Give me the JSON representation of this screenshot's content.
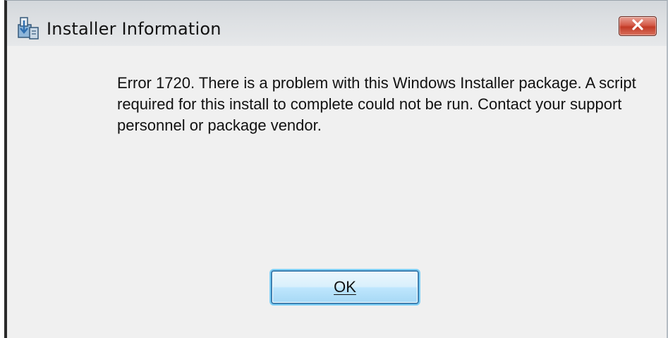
{
  "window": {
    "title": "Installer Information",
    "icon": "installer-icon",
    "close_icon": "close-icon"
  },
  "message": {
    "text": "Error 1720. There is a problem with this Windows Installer package. A script required for this install to complete could not be run. Contact your support personnel or package vendor."
  },
  "buttons": {
    "ok_label": "OK"
  },
  "colors": {
    "titlebar": "#dcdfe2",
    "client": "#f0f0f0",
    "close_button": "#c23a26",
    "ok_border": "#3c7fb1"
  }
}
